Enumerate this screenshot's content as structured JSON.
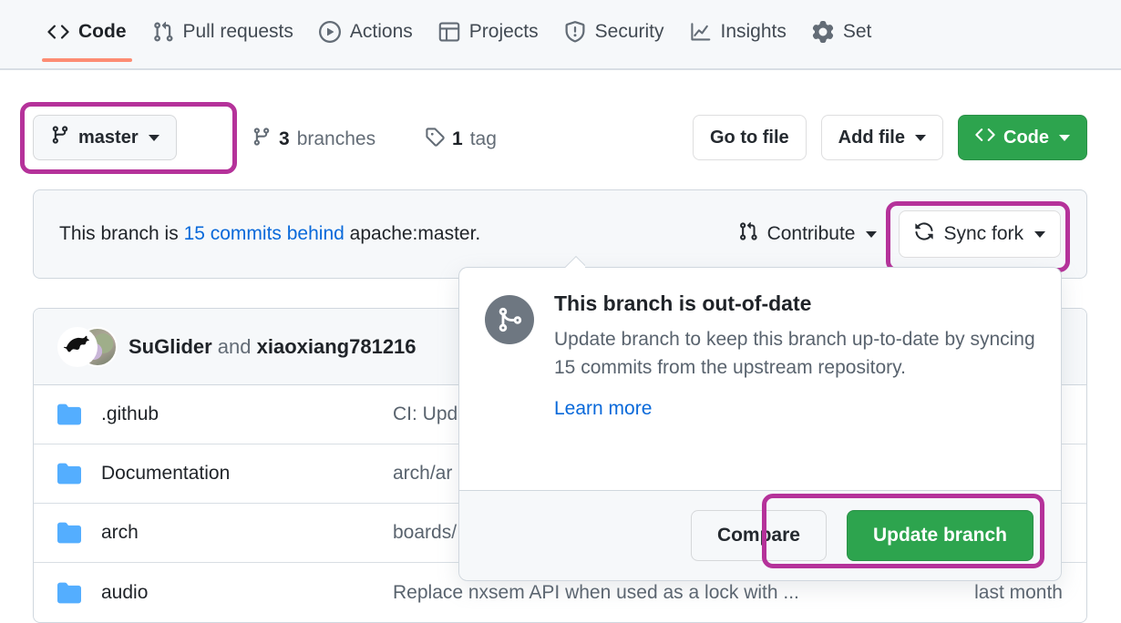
{
  "repo_nav": {
    "items": [
      {
        "label": "Code",
        "icon": "code-icon",
        "active": true
      },
      {
        "label": "Pull requests",
        "icon": "git-pull-request-icon",
        "active": false
      },
      {
        "label": "Actions",
        "icon": "play-icon",
        "active": false
      },
      {
        "label": "Projects",
        "icon": "table-icon",
        "active": false
      },
      {
        "label": "Security",
        "icon": "shield-icon",
        "active": false
      },
      {
        "label": "Insights",
        "icon": "graph-icon",
        "active": false
      },
      {
        "label": "Set",
        "icon": "gear-icon",
        "active": false
      }
    ]
  },
  "branch_bar": {
    "current_branch": "master",
    "branches_count": "3",
    "branches_label": "branches",
    "tags_count": "1",
    "tags_label": "tag",
    "go_to_file": "Go to file",
    "add_file": "Add file",
    "code_button": "Code"
  },
  "status_banner": {
    "prefix": "This branch is ",
    "link": "15 commits behind",
    "suffix": " apache:master.",
    "contribute": "Contribute",
    "sync_fork": "Sync fork"
  },
  "commit_head": {
    "author": "SuGlider",
    "conjunction": " and ",
    "coauthor": "xiaoxiang781216"
  },
  "files": {
    "rows": [
      {
        "name": ".github",
        "message": "CI: Upd",
        "age": ""
      },
      {
        "name": "Documentation",
        "message": "arch/ar",
        "age": ""
      },
      {
        "name": "arch",
        "message": "boards/",
        "age": ""
      },
      {
        "name": "audio",
        "message": "Replace nxsem API when used as a lock with ...",
        "age": "last month"
      }
    ]
  },
  "sync_popup": {
    "title": "This branch is out-of-date",
    "body": "Update branch to keep this branch up-to-date by syncing 15 commits from the upstream repository.",
    "learn_more": "Learn more",
    "compare": "Compare",
    "update_branch": "Update branch"
  },
  "colors": {
    "accent_green": "#2da44e",
    "link_blue": "#0969da",
    "annotation_magenta": "#b5329a",
    "active_tab_underline": "#fd8c73",
    "folder_blue": "#54aeff",
    "panel_gray": "#f6f8fa",
    "border_gray": "#d0d7de"
  }
}
